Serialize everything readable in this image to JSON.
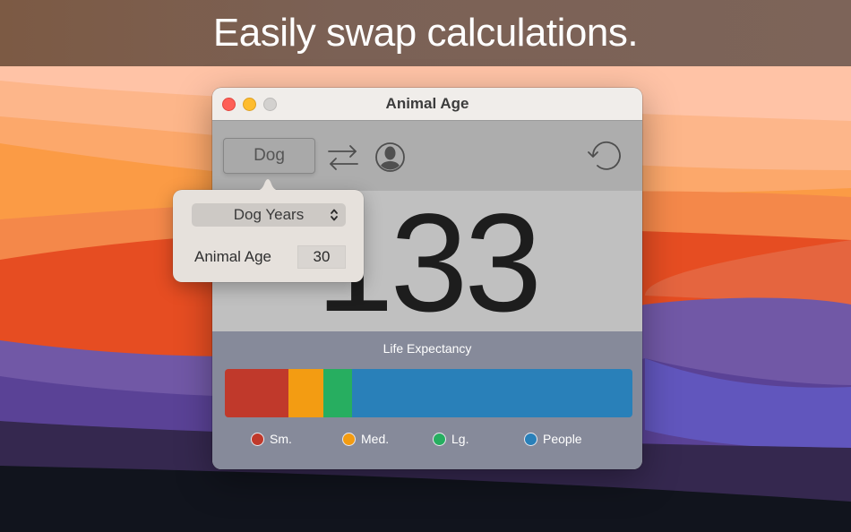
{
  "banner": {
    "title": "Easily swap calculations."
  },
  "window": {
    "title": "Animal Age",
    "traffic_lights": [
      "close",
      "minimize",
      "zoom"
    ]
  },
  "toolbar": {
    "species_button_label": "Dog",
    "swap_icon": "swap-arrows-icon",
    "person_icon": "person-circle-icon",
    "reset_icon": "counterclockwise-reset-icon"
  },
  "result": {
    "value": "133"
  },
  "popover": {
    "unit_selected": "Dog Years",
    "age_label": "Animal Age",
    "age_value": "30"
  },
  "life_expectancy": {
    "title": "Life Expectancy",
    "segments": [
      {
        "name": "Sm.",
        "color": "#c0392b",
        "fraction": 0.156
      },
      {
        "name": "Med.",
        "color": "#f39c12",
        "fraction": 0.086
      },
      {
        "name": "Lg.",
        "color": "#27ae60",
        "fraction": 0.07
      },
      {
        "name": "People",
        "color": "#2980b9",
        "fraction": 0.688
      }
    ]
  },
  "colors": {
    "titlebar": "#f0edea",
    "toolbar": "#adadad",
    "result_panel": "#c0c0c0",
    "life_panel": "#868a9a",
    "popover": "#e6e1dc"
  }
}
